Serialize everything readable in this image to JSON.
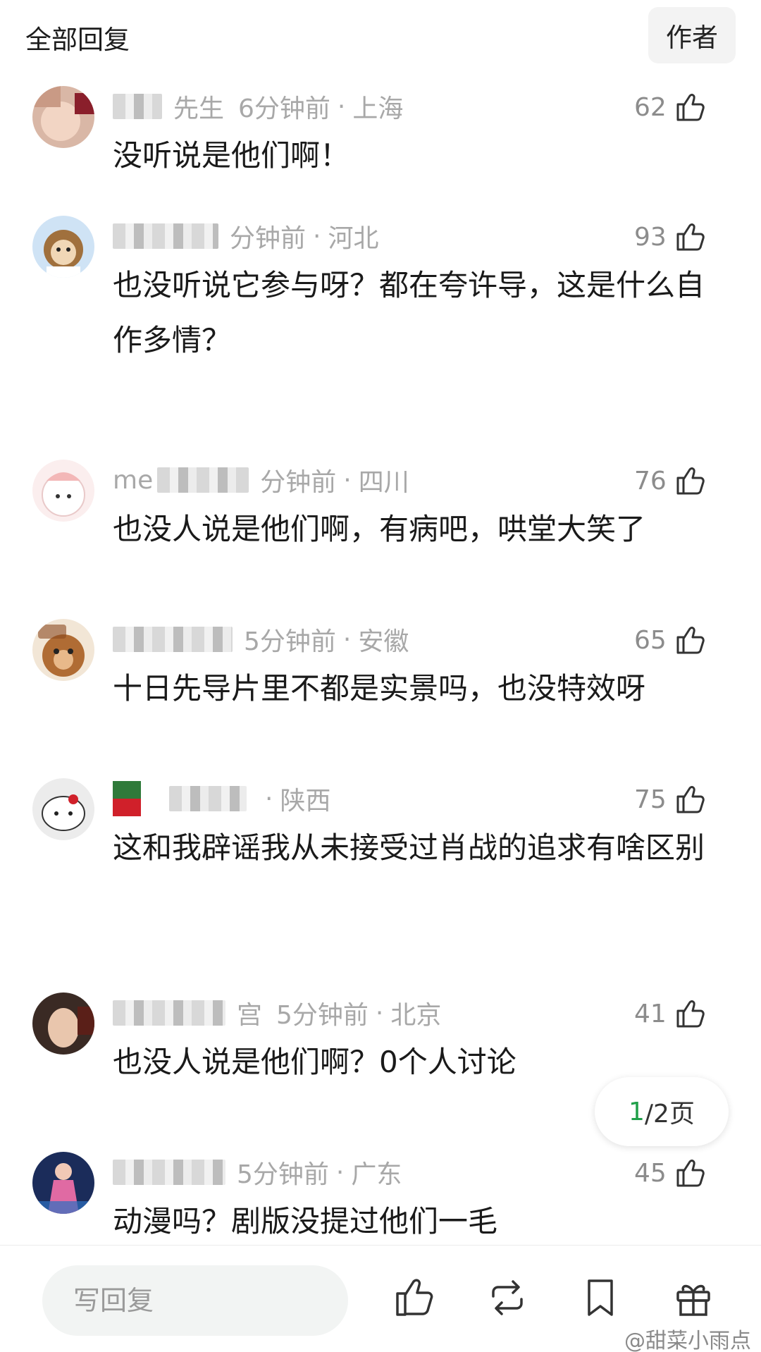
{
  "header": {
    "title": "全部回复",
    "author_label": "作者"
  },
  "comments": [
    {
      "user": "先生",
      "time": "6分钟前",
      "location": "上海",
      "likes": "62",
      "text": "没听说是他们啊！"
    },
    {
      "user": "",
      "time": "分钟前",
      "location": "河北",
      "likes": "93",
      "text": "也没听说它参与呀？都在夸许导，这是什么自作多情？"
    },
    {
      "user": "me",
      "time": "分钟前",
      "location": "四川",
      "likes": "76",
      "text": "也没人说是他们啊，有病吧，哄堂大笑了"
    },
    {
      "user": "",
      "time": "5分钟前",
      "location": "安徽",
      "likes": "65",
      "text": "十日先导片里不都是实景吗，也没特效呀"
    },
    {
      "user": "",
      "time": "",
      "location": "陕西",
      "likes": "75",
      "text": "这和我辟谣我从未接受过肖战的追求有啥区别"
    },
    {
      "user": "宫",
      "time": "5分钟前",
      "location": "北京",
      "likes": "41",
      "text": "也没人说是他们啊？0个人讨论"
    },
    {
      "user": "",
      "time": "5分钟前",
      "location": "广东",
      "likes": "45",
      "text": "动漫吗？剧版没提过他们一毛"
    }
  ],
  "pagination": {
    "current": "1",
    "rest": "/2页"
  },
  "bottom_bar": {
    "reply_placeholder": "写回复",
    "icons": [
      "thumbs-up-icon",
      "repost-icon",
      "bookmark-icon",
      "gift-icon"
    ]
  },
  "watermark": "@甜菜小雨点",
  "colors": {
    "accent_green": "#21a04a",
    "meta_gray": "#a8a8a8",
    "pill_bg": "#f3f3f3"
  }
}
